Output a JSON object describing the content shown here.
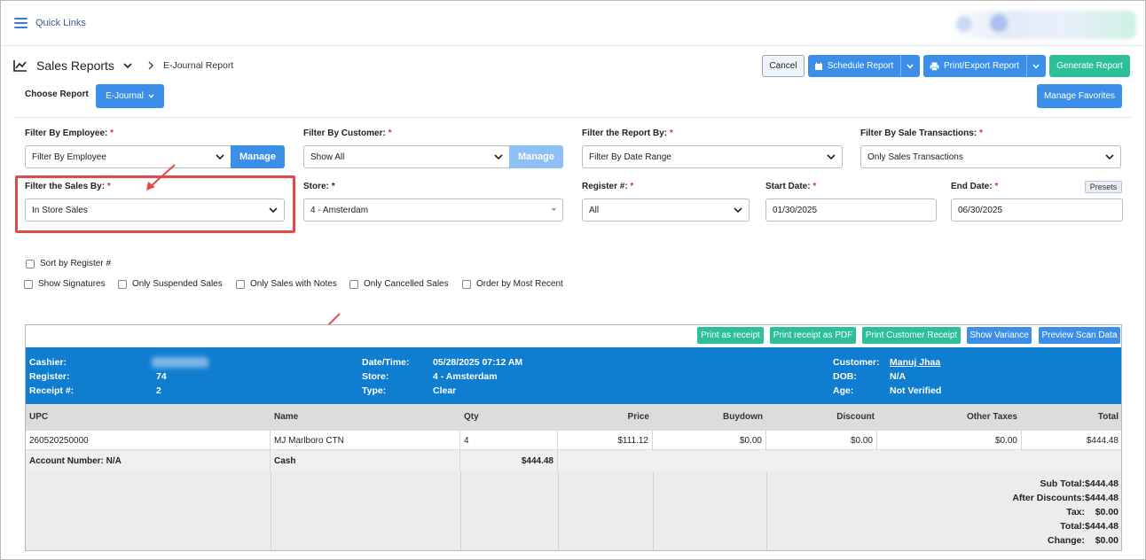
{
  "topbar": {
    "quick_links": "Quick Links"
  },
  "breadcrumb": {
    "title": "Sales Reports",
    "sub": "E-Journal Report"
  },
  "actions": {
    "cancel": "Cancel",
    "schedule": "Schedule Report",
    "print_export": "Print/Export Report",
    "generate": "Generate Report"
  },
  "choose_report": {
    "label": "Choose Report",
    "value": "E-Journal",
    "manage_favorites": "Manage Favorites"
  },
  "filters": {
    "employee": {
      "label": "Filter By Employee:",
      "value": "Filter By Employee",
      "manage": "Manage"
    },
    "customer": {
      "label": "Filter By Customer:",
      "value": "Show All",
      "manage": "Manage"
    },
    "report_by": {
      "label": "Filter the Report By:",
      "value": "Filter By Date Range"
    },
    "sale_transactions": {
      "label": "Filter By Sale Transactions:",
      "value": "Only Sales Transactions"
    },
    "sales_by": {
      "label": "Filter the Sales By:",
      "value": "In Store Sales"
    },
    "store": {
      "label": "Store:",
      "value": "4 - Amsterdam"
    },
    "register": {
      "label": "Register #:",
      "value": "All"
    },
    "start_date": {
      "label": "Start Date:",
      "value": "01/30/2025"
    },
    "end_date": {
      "label": "End Date:",
      "value": "06/30/2025",
      "presets": "Presets"
    },
    "required_mark": "*"
  },
  "options": {
    "sort_by_register": "Sort by Register #",
    "show_signatures": "Show Signatures",
    "only_suspended": "Only Suspended Sales",
    "only_notes": "Only Sales with Notes",
    "only_cancelled": "Only Cancelled Sales",
    "order_recent": "Order by Most Recent"
  },
  "receipt_buttons": {
    "print_receipt": "Print as receipt",
    "print_pdf": "Print receipt as PDF",
    "print_customer": "Print Customer Receipt",
    "show_variance": "Show Variance",
    "preview_scan": "Preview Scan Data"
  },
  "receipt_header": {
    "cashier_label": "Cashier:",
    "register_label": "Register:",
    "register_value": "74",
    "receipt_label": "Receipt #:",
    "receipt_value": "2",
    "datetime_label": "Date/Time:",
    "datetime_value": "05/28/2025 07:12 AM",
    "store_label": "Store:",
    "store_value": "4 - Amsterdam",
    "type_label": "Type:",
    "type_value": "Clear",
    "customer_label": "Customer:",
    "customer_value": "Manuj Jhaa",
    "dob_label": "DOB:",
    "dob_value": "N/A",
    "age_label": "Age:",
    "age_value": "Not Verified"
  },
  "table": {
    "columns": [
      "UPC",
      "Name",
      "Qty",
      "Price",
      "Buydown",
      "Discount",
      "Other Taxes",
      "Total"
    ],
    "row": {
      "upc": "260520250000",
      "name": "MJ Marlboro CTN",
      "qty": "4",
      "price": "$111.12",
      "buydown": "$0.00",
      "discount": "$0.00",
      "other_taxes": "$0.00",
      "total": "$444.48"
    },
    "payment": {
      "account": "Account Number: N/A",
      "method": "Cash",
      "amount": "$444.48"
    }
  },
  "totals": {
    "subtotal_label": "Sub Total:",
    "subtotal": "$444.48",
    "after_discounts_label": "After Discounts:",
    "after_discounts": "$444.48",
    "tax_label": "Tax:",
    "tax": "$0.00",
    "total_label": "Total:",
    "total": "$444.48",
    "change_label": "Change:",
    "change": "$0.00"
  },
  "colors": {
    "primary_blue": "#3b8fe8",
    "teal": "#2cbf9a",
    "header_blue": "#0f7ed0",
    "highlight_red": "#e04a4a"
  }
}
